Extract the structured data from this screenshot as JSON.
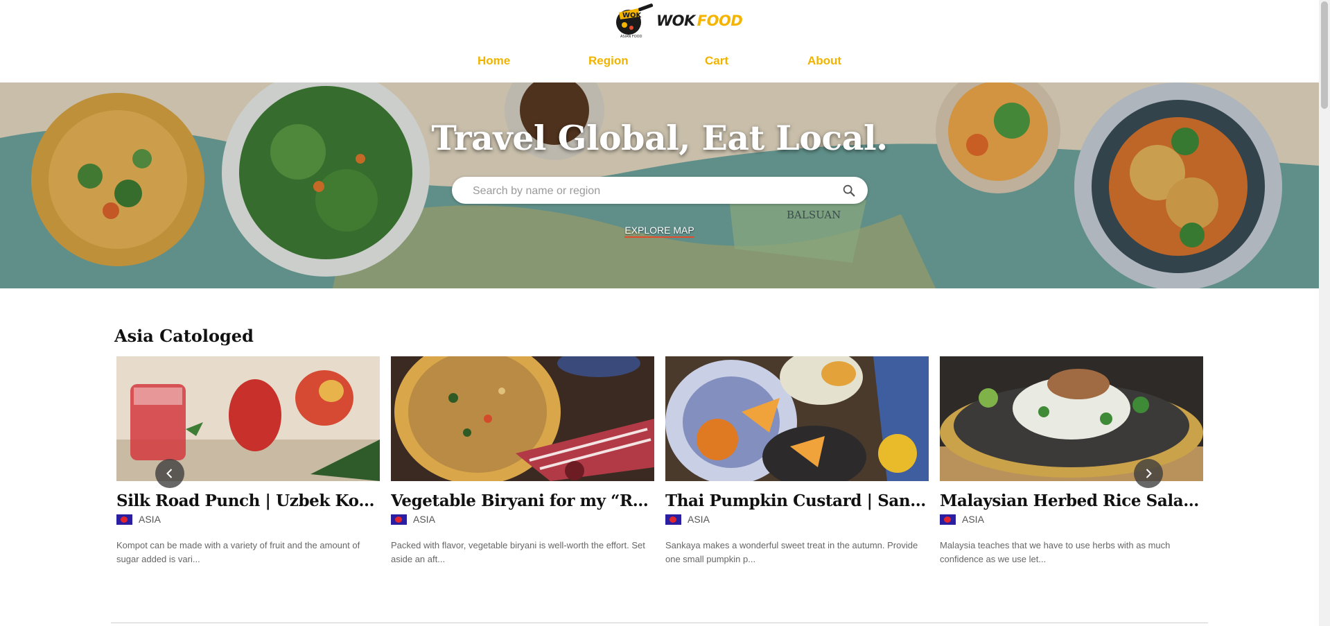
{
  "brand": {
    "logo_badge": "WOK",
    "logo_sub": "ASIAN FOOD",
    "name_1": "WOK",
    "name_2": "FOOD"
  },
  "nav": [
    {
      "label": "Home"
    },
    {
      "label": "Region"
    },
    {
      "label": "Cart"
    },
    {
      "label": "About"
    }
  ],
  "hero": {
    "title": "Travel Global, Eat Local.",
    "search_placeholder": "Search by name or region",
    "explore_label": "EXPLORE MAP",
    "map_label": "BALSUAN"
  },
  "section": {
    "title": "Asia Catologed"
  },
  "cards": [
    {
      "title": "Silk Road Punch | Uzbek Kompot",
      "region": "ASIA",
      "desc": "Kompot can be made with a variety of fruit and the amount of sugar added is vari..."
    },
    {
      "title": "Vegetable Biryani for my “Rick...",
      "region": "ASIA",
      "desc": "Packed with flavor, vegetable biryani is well-worth the effort. Set aside an aft..."
    },
    {
      "title": "Thai Pumpkin Custard | Sankaya",
      "region": "ASIA",
      "desc": "Sankaya makes a wonderful sweet treat in the autumn. Provide one small pumpkin p..."
    },
    {
      "title": "Malaysian Herbed Rice Salad | ...",
      "region": "ASIA",
      "desc": "Malaysia teaches that we have to use herbs with as much confidence as we use let..."
    }
  ],
  "colors": {
    "accent": "#f0b400",
    "explore_underline": "#e34b2b",
    "flag_blue": "#2a1fa0",
    "flag_red": "#e3262e"
  },
  "icons": {
    "search": "search-icon",
    "prev": "chevron-left-icon",
    "next": "chevron-right-icon"
  }
}
